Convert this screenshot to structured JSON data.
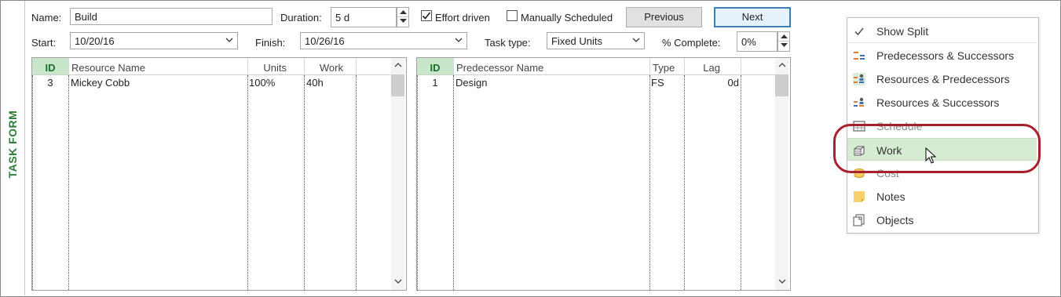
{
  "sidebar": {
    "label": "TASK FORM"
  },
  "form": {
    "name": {
      "label": "Name:",
      "value": "Build"
    },
    "duration": {
      "label": "Duration:",
      "value": "5 d"
    },
    "effort_driven": {
      "label": "Effort driven",
      "checked": true
    },
    "manually_scheduled": {
      "label": "Manually Scheduled",
      "checked": false
    },
    "previous_label": "Previous",
    "next_label": "Next",
    "start": {
      "label": "Start:",
      "value": "10/20/16"
    },
    "finish": {
      "label": "Finish:",
      "value": "10/26/16"
    },
    "task_type": {
      "label": "Task type:",
      "value": "Fixed Units"
    },
    "percent_complete": {
      "label": "% Complete:",
      "value": "0%"
    }
  },
  "resource_table": {
    "headers": {
      "id": "ID",
      "name": "Resource Name",
      "units": "Units",
      "work": "Work"
    },
    "rows": [
      {
        "id": "3",
        "name": "Mickey Cobb",
        "units": "100%",
        "work": "40h"
      }
    ]
  },
  "predecessor_table": {
    "headers": {
      "id": "ID",
      "name": "Predecessor Name",
      "type": "Type",
      "lag": "Lag"
    },
    "rows": [
      {
        "id": "1",
        "name": "Design",
        "type": "FS",
        "lag": "0d"
      }
    ]
  },
  "context_menu": {
    "items": [
      {
        "label": "Show Split",
        "icon": "checkmark-icon"
      },
      {
        "label": "Predecessors & Successors",
        "icon": "predecessors-successors-icon"
      },
      {
        "label": "Resources & Predecessors",
        "icon": "resources-predecessors-icon"
      },
      {
        "label": "Resources & Successors",
        "icon": "resources-successors-icon"
      },
      {
        "label": "Schedule",
        "icon": "schedule-icon"
      },
      {
        "label": "Work",
        "icon": "work-icon"
      },
      {
        "label": "Cost",
        "icon": "cost-icon"
      },
      {
        "label": "Notes",
        "icon": "notes-icon"
      },
      {
        "label": "Objects",
        "icon": "objects-icon"
      }
    ],
    "highlighted": "Work"
  },
  "colors": {
    "accent_green": "#2f7d3b",
    "id_header_bg": "#c8e6c9",
    "highlight_bg": "#d6ecd2",
    "annotation": "#a8202c",
    "next_border": "#3c7fb1"
  }
}
